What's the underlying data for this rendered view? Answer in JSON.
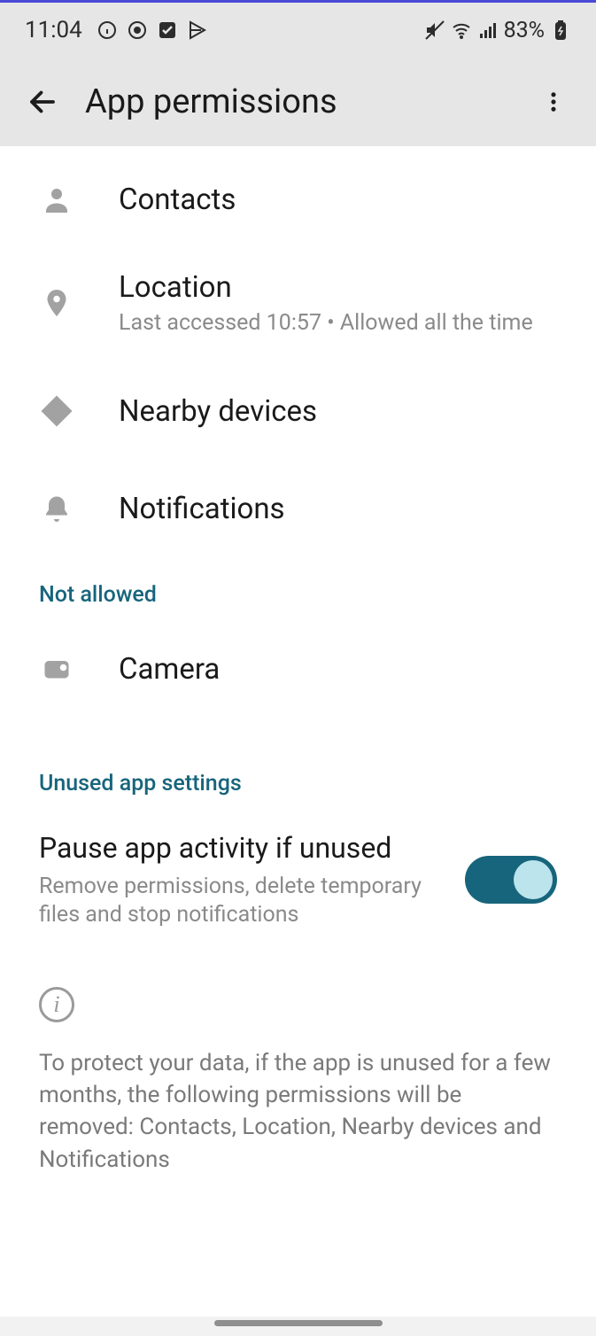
{
  "status": {
    "time": "11:04",
    "battery": "83%"
  },
  "appbar": {
    "title": "App permissions"
  },
  "permissions_allowed": [
    {
      "icon": "contacts-icon",
      "label": "Contacts",
      "sub": ""
    },
    {
      "icon": "location-icon",
      "label": "Location",
      "sub": "Last accessed 10:57 • Allowed all the time"
    },
    {
      "icon": "nearby-icon",
      "label": "Nearby devices",
      "sub": ""
    },
    {
      "icon": "notifications-icon",
      "label": "Notifications",
      "sub": ""
    }
  ],
  "sections": {
    "not_allowed": "Not allowed",
    "unused": "Unused app settings"
  },
  "permissions_not_allowed": [
    {
      "icon": "camera-icon",
      "label": "Camera",
      "sub": ""
    }
  ],
  "pause": {
    "title": "Pause app activity if unused",
    "sub": "Remove permissions, delete temporary files and stop notifications",
    "enabled": true
  },
  "info": {
    "text": "To protect your data, if the app is unused for a few months, the following permissions will be removed: Contacts, Location, Nearby devices and Notifications"
  }
}
